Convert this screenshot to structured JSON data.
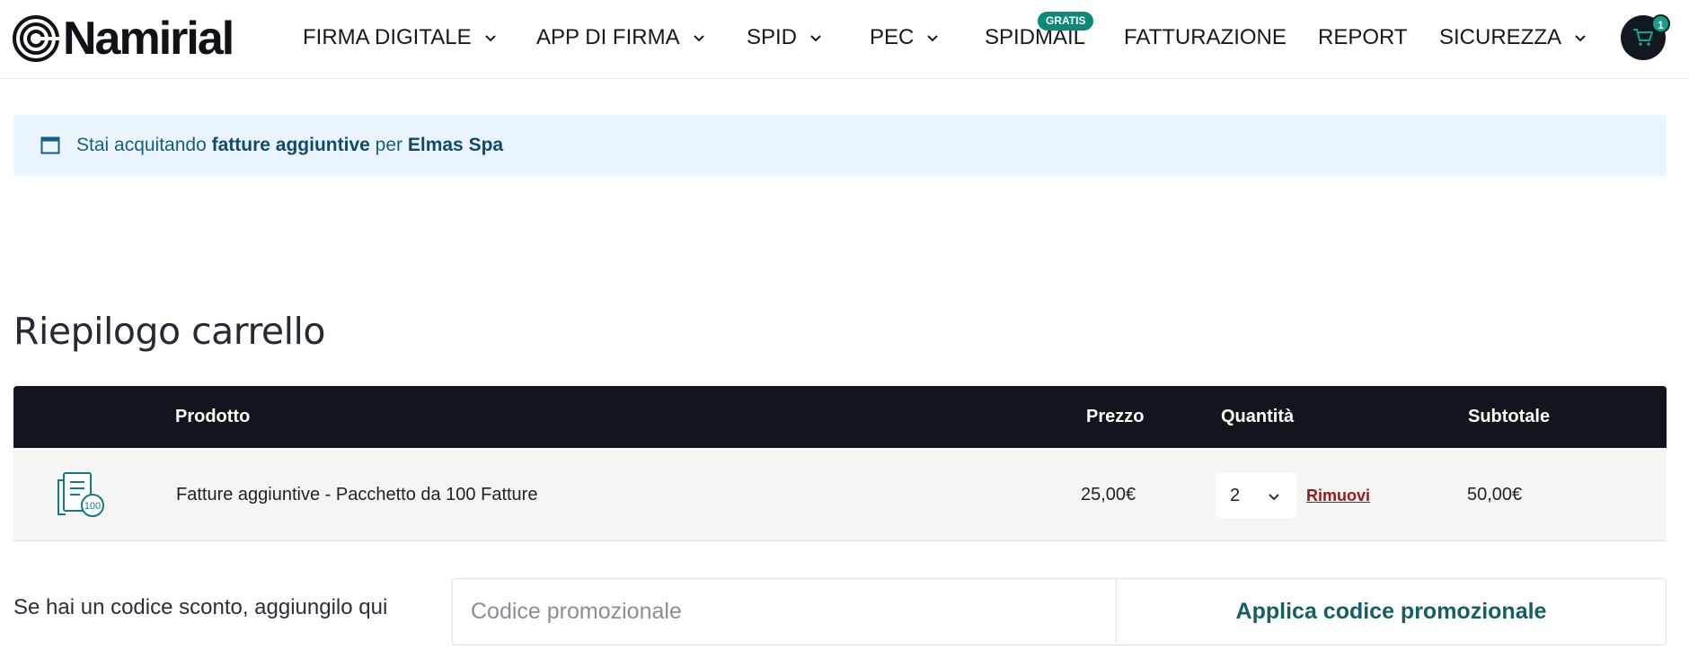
{
  "header": {
    "logo_text": "Namirial",
    "nav": [
      {
        "label": "FIRMA DIGITALE",
        "has_dropdown": true
      },
      {
        "label": "APP DI FIRMA",
        "has_dropdown": true
      },
      {
        "label": "SPID",
        "has_dropdown": true
      },
      {
        "label": "PEC",
        "has_dropdown": true
      },
      {
        "label": "SPIDMAIL",
        "has_dropdown": false
      },
      {
        "label": "FATTURAZIONE",
        "has_dropdown": false
      },
      {
        "label": "REPORT",
        "has_dropdown": false
      },
      {
        "label": "SICUREZZA",
        "has_dropdown": true
      }
    ],
    "spidmail_badge": "GRATIS",
    "cart_count": "1",
    "cart_icon": "cart-icon"
  },
  "banner": {
    "prefix": "Stai acquitando",
    "product": "fatture aggiuntive",
    "middle": "per",
    "company": "Elmas Spa",
    "icon": "window-icon"
  },
  "cart": {
    "title": "Riepilogo carrello",
    "columns": {
      "product": "Prodotto",
      "price": "Prezzo",
      "quantity": "Quantità",
      "subtotal": "Subtotale"
    },
    "items": [
      {
        "name": "Fatture aggiuntive - Pacchetto da 100 Fatture",
        "icon": "invoice-100-icon",
        "icon_label": "100",
        "price": "25,00€",
        "quantity": "2",
        "remove_label": "Rimuovi",
        "subtotal": "50,00€"
      }
    ]
  },
  "promo": {
    "label": "Se hai un codice sconto, aggiungilo qui",
    "placeholder": "Codice promozionale",
    "button_label": "Applica codice promozionale"
  },
  "colors": {
    "table_header": "#11161d",
    "banner_bg": "#e9f4fc",
    "accent_green": "#0c8a78",
    "remove_red": "#a11616"
  }
}
